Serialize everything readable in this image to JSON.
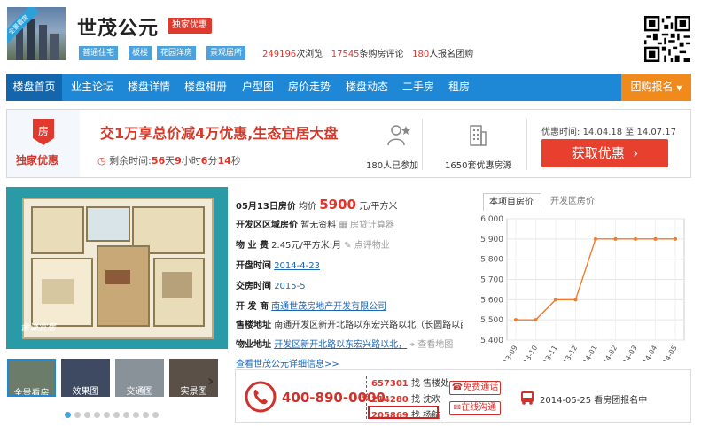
{
  "header": {
    "thumb_badge": "全景看房",
    "title": "世茂公元",
    "exclusive_badge": "独家优惠",
    "tags": [
      "普通住宅",
      "板楼",
      "花园洋房",
      "景观居所"
    ],
    "views": "249196",
    "views_suffix": "次浏览",
    "reviews": "17545",
    "reviews_suffix": "条购房评论",
    "signups": "180",
    "signups_suffix": "人报名团购"
  },
  "nav": {
    "items": [
      "楼盘首页",
      "业主论坛",
      "楼盘详情",
      "楼盘相册",
      "户型图",
      "房价走势",
      "楼盘动态",
      "二手房",
      "租房"
    ],
    "group_button": "团购报名"
  },
  "promo": {
    "badge_label": "独家优惠",
    "badge_icon": "房",
    "title": "交1万享总价减4万优惠,生态宜居大盘",
    "countdown_prefix": "剩余时间:",
    "days": "56",
    "days_unit": "天",
    "hours": "9",
    "hours_unit": "小时",
    "minutes": "6",
    "minutes_unit": "分",
    "seconds": "14",
    "seconds_unit": "秒",
    "joined": "180人已参加",
    "houses": "1650套优惠房源",
    "time_label": "优惠时间:",
    "time_range": "14.04.18 至 14.07.17",
    "get_button": "获取优惠"
  },
  "gallery": {
    "plan_label": "舍谦宜居",
    "thumbs": [
      "全景看房",
      "效果图",
      "交通图",
      "实景图"
    ],
    "dots": 10
  },
  "info": {
    "price_date": "05月13日房价",
    "price_prefix": "均价",
    "price": "5900",
    "price_unit": "元/平方米",
    "district_price_label": "开发区区域房价",
    "district_price_value": "暂无资料",
    "loan_calc": "房贷计算器",
    "mgmt_fee_label": "物 业 费",
    "mgmt_fee_value": "2.45元/平方米.月",
    "mgmt_review": "点评物业",
    "open_label": "开盘时间",
    "open_value": "2014-4-23",
    "deliver_label": "交房时间",
    "deliver_value": "2015-5",
    "developer_label": "开 发 商",
    "developer_value": "南通世茂房地产开发有限公司",
    "sales_label": "售楼地址",
    "sales_value": "南通开发区新开北路以东宏兴路以北（长圆路以西",
    "prop_label": "物业地址",
    "prop_value": "开发区新开北路以东宏兴路以北，",
    "map_link": "查看地图",
    "more_link": "查看世茂公元详细信息>>"
  },
  "chart_tabs": {
    "project": "本项目房价",
    "district": "开发区房价"
  },
  "chart_data": {
    "type": "line",
    "categories": [
      "13-09",
      "13-10",
      "13-11",
      "13-12",
      "14-01",
      "14-02",
      "14-03",
      "14-04",
      "14-05"
    ],
    "series": [
      {
        "values": [
          5500,
          5500,
          5600,
          5600,
          5900,
          5900,
          5900,
          5900,
          5900
        ]
      }
    ],
    "ylim": [
      5400,
      6000
    ],
    "yticks": [
      "6,000",
      "5,900",
      "5,800",
      "5,700",
      "5,600",
      "5,500",
      "5,400"
    ],
    "ytick_values": [
      6000,
      5900,
      5800,
      5700,
      5600,
      5500,
      5400
    ],
    "color": "#f07b2a",
    "grid": true
  },
  "contact": {
    "phone": "400-890-0000",
    "ext_word": "转",
    "lines": [
      {
        "code": "657301",
        "text": "找 售楼处"
      },
      {
        "code": "214280",
        "text": "找 沈欢"
      },
      {
        "code": "205869",
        "text": "找 杨航"
      }
    ],
    "free_call": "免费通话",
    "online_chat": "在线沟通",
    "tour_text": "2014-05-25 看房团报名中"
  }
}
